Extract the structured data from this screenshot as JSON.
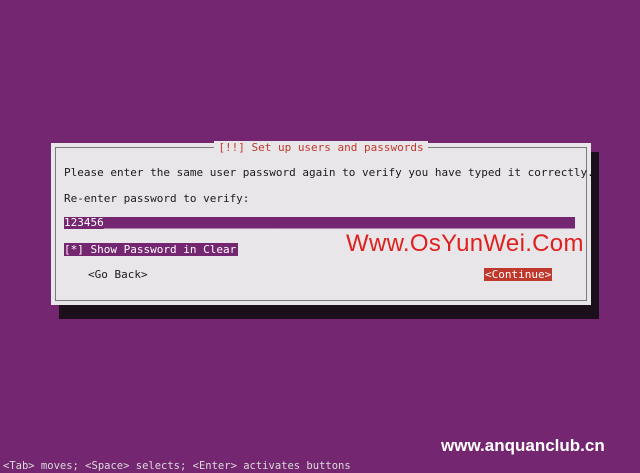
{
  "dialog": {
    "title": "[!!] Set up users and passwords",
    "prompt_line1": "Please enter the same user password again to verify you have typed it correctly.",
    "prompt_line2": "Re-enter password to verify:",
    "password_value": "123456",
    "show_password_checkbox": "[*] Show Password in Clear",
    "go_back_button": "<Go Back>",
    "continue_button": "<Continue>"
  },
  "watermarks": {
    "site1": "Www.OsYunWei.Com",
    "site2": "www.anquanclub.cn"
  },
  "status_hint": "<Tab> moves; <Space> selects; <Enter> activates buttons",
  "colors": {
    "background": "#742670",
    "dialog_bg": "#e9e6e9",
    "accent_red": "#c0382b",
    "field_bg": "#742670"
  }
}
